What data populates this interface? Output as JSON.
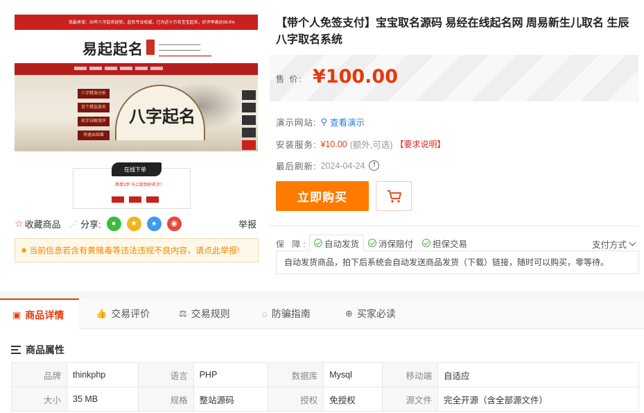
{
  "gallery": {
    "topbar_text": "我最承诺：30年八字起名经验，起名专业权威，已为近十万名宝宝起名，好评率高达99.9%",
    "logo_text": "易起起名",
    "banner_text": "八字起名",
    "banner_buttons": [
      "八字精准分析",
      "百个精选美名",
      "名字详解测评",
      "快速出结果"
    ],
    "card_title": "在线下单",
    "card_red_text": "简单3步 马上就到好名字！"
  },
  "actions": {
    "favorite_label": "收藏商品",
    "share_label": "分享:",
    "report_label": "举报"
  },
  "notice": {
    "text": "当前信息若含有黄赌毒等违法违规不良内容，请点此举报!"
  },
  "product": {
    "title": "【带个人免签支付】宝宝取名源码 易经在线起名网 周易新生儿取名 生辰八字取名系统",
    "price_label": "售 价:",
    "price": "¥100.00",
    "demo_label": "演示网站:",
    "demo_link": "查看演示",
    "install_label": "安装服务:",
    "install_price": "¥10.00",
    "install_optional": "(额外,可选)",
    "install_request": "【要求说明】",
    "refresh_label": "最后刷新:",
    "refresh_date": "2024-04-24",
    "buy_label": "立即购买"
  },
  "guarantee": {
    "label": "保 障:",
    "tabs": [
      "自动发货",
      "消保赔付",
      "担保交易"
    ],
    "pay_method": "支付方式",
    "description": "自动发货商品，拍下后系统会自动发送商品发货（下载）链接，随时可以购买，零等待。"
  },
  "tabs": [
    "商品详情",
    "交易评价",
    "交易规则",
    "防骗指南",
    "买家必读"
  ],
  "attributes": {
    "title": "商品属性",
    "rows": [
      [
        [
          "品牌",
          "thinkphp"
        ],
        [
          "语言",
          "PHP"
        ],
        [
          "数据库",
          "Mysql"
        ],
        [
          "移动端",
          "自适应"
        ]
      ],
      [
        [
          "大小",
          "35 MB"
        ],
        [
          "规格",
          "整站源码"
        ],
        [
          "授权",
          "免授权"
        ],
        [
          "源文件",
          "完全开源（含全部源文件）"
        ]
      ]
    ]
  },
  "colors": {
    "accent": "#e8380d",
    "buy_button": "#ff7b00",
    "link": "#2e7bd2",
    "notice_text": "#f18a00"
  }
}
